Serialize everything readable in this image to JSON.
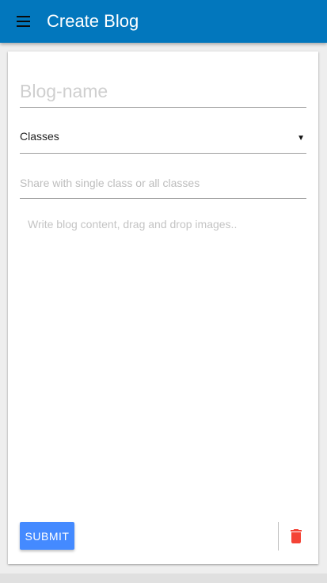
{
  "appbar": {
    "title": "Create Blog",
    "color": "#0277bd",
    "menu_icon": "hamburger-menu-icon"
  },
  "form": {
    "blog_name": {
      "placeholder": "Blog-name",
      "value": ""
    },
    "classes_select": {
      "label": "Classes",
      "icon": "dropdown-caret-icon"
    },
    "share_field": {
      "placeholder": "Share with single class or all classes",
      "value": ""
    },
    "content": {
      "placeholder": "Write blog content, drag and drop images..",
      "value": ""
    }
  },
  "actions": {
    "submit_label": "SUBMIT",
    "submit_color": "#448aff",
    "delete_icon": "trash-icon",
    "delete_color": "#f44336"
  }
}
